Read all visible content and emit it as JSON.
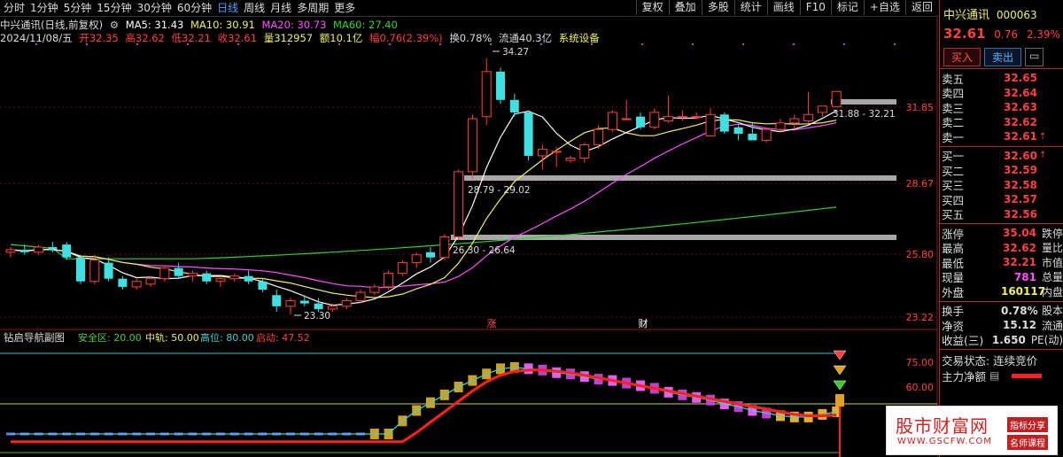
{
  "toolbar": {
    "periods": [
      "分时",
      "1分钟",
      "5分钟",
      "15分钟",
      "30分钟",
      "60分钟",
      "日线",
      "周线",
      "月线",
      "多周期",
      "更多"
    ],
    "active_period": "日线",
    "tools": [
      "复权",
      "叠加",
      "多股",
      "统计",
      "画线",
      "F10",
      "标记",
      "+自选",
      "返回"
    ]
  },
  "info": {
    "title": "中兴通讯(日线,前复权)",
    "ma5": "MA5: 31.43",
    "ma10": "MA10: 30.91",
    "ma20": "MA20: 30.73",
    "ma60": "MA60: 27.40",
    "date": "2024/11/08/五",
    "open": "开32.35",
    "high": "高32.62",
    "low": "低32.21",
    "close": "收32.61",
    "vol": "量312957",
    "amount": "额10.1亿",
    "chg": "幅0.76(2.39%)",
    "turnover": "换0.78%",
    "float": "流通40.3亿",
    "sector": "系统设备"
  },
  "indicator": {
    "name": "钻启导航副图",
    "safe": "安全区: 20.00",
    "mid": "中轨: 50.00",
    "high": "高位: 80.00",
    "start": "启动: 47.52"
  },
  "price_axis": [
    "31.85",
    "28.67",
    "25.80",
    "23.22"
  ],
  "ind_axis": [
    "75.00",
    "60.00"
  ],
  "annotations": {
    "max": "34.27",
    "min": "23.30",
    "z1": "31.88 - 32.21",
    "z2": "28.79 - 29.02",
    "z3": "26.30 - 26.64",
    "m1": "涨",
    "m2": "财"
  },
  "colors": {
    "up": "#ff4040",
    "down": "#40e0e0",
    "ma5": "#ffffff",
    "ma10": "#f0f060",
    "ma20": "#ff50ff",
    "ma60": "#30d030"
  },
  "candles": [
    [
      25.6,
      25.8,
      25.4,
      25.7
    ],
    [
      25.7,
      25.9,
      25.5,
      25.6
    ],
    [
      25.6,
      25.9,
      25.5,
      25.8
    ],
    [
      25.8,
      26.0,
      25.6,
      25.7
    ],
    [
      25.9,
      26.0,
      25.3,
      25.4
    ],
    [
      25.4,
      25.5,
      24.4,
      24.5
    ],
    [
      24.5,
      25.5,
      24.4,
      25.3
    ],
    [
      25.2,
      25.4,
      24.5,
      24.6
    ],
    [
      24.6,
      24.7,
      24.2,
      24.3
    ],
    [
      24.3,
      24.6,
      24.2,
      24.5
    ],
    [
      24.4,
      24.7,
      24.3,
      24.6
    ],
    [
      24.6,
      25.1,
      24.5,
      25.0
    ],
    [
      25.0,
      25.2,
      24.6,
      24.7
    ],
    [
      24.7,
      24.9,
      24.5,
      24.8
    ],
    [
      24.8,
      24.9,
      24.4,
      24.5
    ],
    [
      24.5,
      24.7,
      24.3,
      24.6
    ],
    [
      24.6,
      24.8,
      24.5,
      24.7
    ],
    [
      24.7,
      24.9,
      24.4,
      24.5
    ],
    [
      24.5,
      24.6,
      24.1,
      24.2
    ],
    [
      24.0,
      24.2,
      23.4,
      23.6
    ],
    [
      23.6,
      23.9,
      23.3,
      23.8
    ],
    [
      23.8,
      24.0,
      23.6,
      23.7
    ],
    [
      23.7,
      23.9,
      23.4,
      23.5
    ],
    [
      23.5,
      23.7,
      23.4,
      23.6
    ],
    [
      23.6,
      23.9,
      23.5,
      23.8
    ],
    [
      23.8,
      24.2,
      23.7,
      24.1
    ],
    [
      24.1,
      24.4,
      24.0,
      24.3
    ],
    [
      24.3,
      24.9,
      24.2,
      24.8
    ],
    [
      24.8,
      25.3,
      24.7,
      25.2
    ],
    [
      25.2,
      25.6,
      25.0,
      25.5
    ],
    [
      25.6,
      25.8,
      25.2,
      25.4
    ],
    [
      25.4,
      26.3,
      25.3,
      26.2
    ],
    [
      26.2,
      29.0,
      26.1,
      28.9
    ],
    [
      28.9,
      31.5,
      28.6,
      31.3
    ],
    [
      31.4,
      34.27,
      31.0,
      33.6
    ],
    [
      33.6,
      33.8,
      32.0,
      32.2
    ],
    [
      32.2,
      32.5,
      31.4,
      31.6
    ],
    [
      31.6,
      31.7,
      29.4,
      29.6
    ],
    [
      29.6,
      30.1,
      29.0,
      29.9
    ],
    [
      29.8,
      30.0,
      29.1,
      29.8
    ],
    [
      29.4,
      29.6,
      29.3,
      29.5
    ],
    [
      29.5,
      30.2,
      29.3,
      30.1
    ],
    [
      30.1,
      31.0,
      29.9,
      30.8
    ],
    [
      30.8,
      31.7,
      30.7,
      31.6
    ],
    [
      31.3,
      32.2,
      31.2,
      31.3
    ],
    [
      31.4,
      31.6,
      30.8,
      30.9
    ],
    [
      30.9,
      31.8,
      30.8,
      31.6
    ],
    [
      31.2,
      32.4,
      31.1,
      31.4
    ],
    [
      31.4,
      31.7,
      31.2,
      31.4
    ],
    [
      31.4,
      31.6,
      31.3,
      31.4
    ],
    [
      30.5,
      31.8,
      30.5,
      31.5
    ],
    [
      31.5,
      31.6,
      30.6,
      30.7
    ],
    [
      30.9,
      31.0,
      30.3,
      30.6
    ],
    [
      30.6,
      31.1,
      30.3,
      30.3
    ],
    [
      30.3,
      30.9,
      30.2,
      30.8
    ],
    [
      30.8,
      31.3,
      30.7,
      31.1
    ],
    [
      31.1,
      31.5,
      30.8,
      31.3
    ],
    [
      31.2,
      32.6,
      31.1,
      31.5
    ],
    [
      31.6,
      31.9,
      31.4,
      31.9
    ],
    [
      31.88,
      32.62,
      31.88,
      32.61
    ]
  ],
  "ind": [
    [
      5,
      3.5
    ],
    [
      6,
      3.8
    ],
    [
      5,
      3.5
    ],
    [
      7,
      4.2
    ],
    [
      4,
      3.6
    ],
    [
      3,
      3.3
    ],
    [
      4,
      3.2
    ],
    [
      3,
      3.1
    ],
    [
      2,
      3.0
    ],
    [
      3,
      2.9
    ],
    [
      4,
      2.9
    ],
    [
      5,
      3.0
    ],
    [
      3,
      3.0
    ],
    [
      4,
      3.1
    ],
    [
      3,
      3.1
    ],
    [
      2,
      3.0
    ],
    [
      3,
      3.0
    ],
    [
      2,
      3.0
    ],
    [
      2,
      3.0
    ],
    [
      1,
      2.9
    ],
    [
      2,
      2.9
    ],
    [
      3,
      2.9
    ],
    [
      3,
      3.0
    ],
    [
      4,
      3.1
    ],
    [
      5,
      3.3
    ],
    [
      8,
      3.8
    ],
    [
      12,
      4.8
    ],
    [
      20,
      8.0
    ],
    [
      30,
      14.0
    ],
    [
      38,
      21.0
    ],
    [
      44,
      29.0
    ],
    [
      50,
      37.0
    ],
    [
      56,
      45.0
    ],
    [
      61,
      53.0
    ],
    [
      66,
      60.0
    ],
    [
      70,
      65.0
    ],
    [
      71,
      68.0
    ],
    [
      70,
      69.0
    ],
    [
      69,
      69.0
    ],
    [
      67,
      68.0
    ],
    [
      66,
      67.0
    ],
    [
      64,
      65.0
    ],
    [
      62,
      63.0
    ],
    [
      61,
      61.0
    ],
    [
      59,
      59.0
    ],
    [
      57,
      57.0
    ],
    [
      55,
      55.0
    ],
    [
      52,
      53.0
    ],
    [
      50,
      51.0
    ],
    [
      48,
      49.0
    ],
    [
      46,
      47.0
    ],
    [
      43,
      45.0
    ],
    [
      41,
      43.0
    ],
    [
      38,
      41.0
    ],
    [
      36,
      39.0
    ],
    [
      34,
      37.0
    ],
    [
      33,
      35.0
    ],
    [
      33,
      34.0
    ],
    [
      35,
      34.0
    ],
    [
      37,
      34.5
    ]
  ],
  "panel": {
    "name": "中兴通讯",
    "code": "000063",
    "price": "32.61",
    "chg": "0.76",
    "pct": "2.39%",
    "buy_btn": "买入",
    "sell_btn": "卖出",
    "more_btn": "▭",
    "sells": [
      {
        "label": "卖五",
        "value": "32.65"
      },
      {
        "label": "卖四",
        "value": "32.64"
      },
      {
        "label": "卖三",
        "value": "32.63"
      },
      {
        "label": "卖二",
        "value": "32.62"
      },
      {
        "label": "卖一",
        "value": "32.61"
      }
    ],
    "buys": [
      {
        "label": "买一",
        "value": "32.60"
      },
      {
        "label": "买二",
        "value": "32.59"
      },
      {
        "label": "买三",
        "value": "32.58"
      },
      {
        "label": "买四",
        "value": "32.57"
      },
      {
        "label": "买五",
        "value": "32.56"
      }
    ],
    "stats": [
      {
        "label": "涨停",
        "value": "35.04",
        "extra": "跌停"
      },
      {
        "label": "最高",
        "value": "32.62",
        "extra": "量比"
      },
      {
        "label": "最低",
        "value": "32.21",
        "extra": "市值"
      },
      {
        "label": "现量",
        "value": "781",
        "extra": "总量"
      },
      {
        "label": "外盘",
        "value": "160117",
        "extra": "内盘"
      }
    ],
    "stats2": [
      {
        "label": "换手",
        "value": "0.78%",
        "extra": "股本"
      },
      {
        "label": "净资",
        "value": "15.12",
        "extra": "流通"
      },
      {
        "label": "收益(三)",
        "value": "1.650",
        "extra": "PE(动)"
      }
    ],
    "state": "交易状态: 连续竞价",
    "main_net": "主力净额"
  },
  "watermark": {
    "title": "股市财富网",
    "url": "WWW.GSCFW.COM",
    "tag1": "指标分享",
    "tag2": "名师课程"
  }
}
